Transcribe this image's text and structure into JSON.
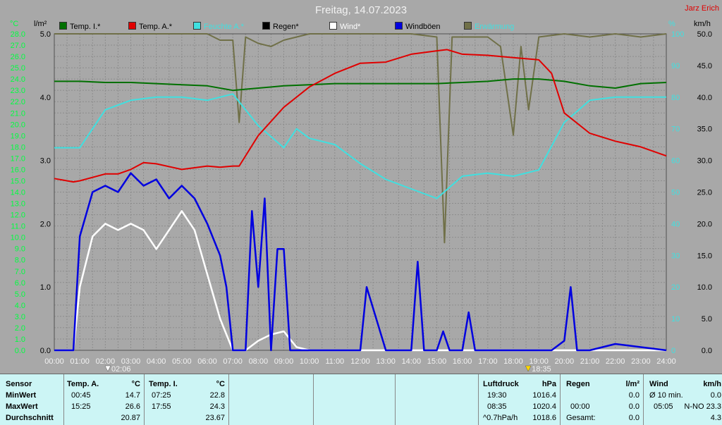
{
  "title": "Freitag, 14.07.2023",
  "author": "Jarz Erich",
  "axis_units": {
    "temp": "°C",
    "rain": "l/m²",
    "humidity": "%",
    "wind": "km/h"
  },
  "legend": [
    {
      "label": "Temp. I.*",
      "color": "#007000",
      "text_color": "#000000"
    },
    {
      "label": "Temp. A.*",
      "color": "#e00000",
      "text_color": "#000000"
    },
    {
      "label": "Feuchte A.*",
      "color": "#40e0e0",
      "text_color": "#40e0e0"
    },
    {
      "label": "Regen*",
      "color": "#000000",
      "text_color": "#000000"
    },
    {
      "label": "Wind*",
      "color": "#ffffff",
      "text_color": "#ffffff"
    },
    {
      "label": "Windböen",
      "color": "#0000e0",
      "text_color": "#000000"
    },
    {
      "label": "Erwärmung",
      "color": "#707048",
      "text_color": "#40e0e0"
    }
  ],
  "marker_labels": {
    "sunrise": "02:06",
    "sunset": "18:35"
  },
  "chart_data": {
    "type": "line",
    "xlabel": "",
    "x_range": [
      "00:00",
      "24:00"
    ],
    "x_ticks": [
      "00:00",
      "01:00",
      "02:00",
      "03:00",
      "04:00",
      "05:00",
      "06:00",
      "07:00",
      "08:00",
      "09:00",
      "10:00",
      "11:00",
      "12:00",
      "13:00",
      "14:00",
      "15:00",
      "16:00",
      "17:00",
      "18:00",
      "19:00",
      "20:00",
      "21:00",
      "22:00",
      "23:00",
      "24:00"
    ],
    "axes": {
      "temp": {
        "label": "°C",
        "range": [
          0,
          28
        ],
        "ticks": [
          "0.0",
          "1.0",
          "2.0",
          "3.0",
          "4.0",
          "5.0",
          "6.0",
          "7.0",
          "8.0",
          "9.0",
          "10.0",
          "11.0",
          "12.0",
          "13.0",
          "14.0",
          "15.0",
          "16.0",
          "17.0",
          "18.0",
          "19.0",
          "20.0",
          "21.0",
          "22.0",
          "23.0",
          "24.0",
          "25.0",
          "26.0",
          "27.0",
          "28.0"
        ]
      },
      "rain": {
        "label": "l/m²",
        "range": [
          0,
          5
        ],
        "ticks": [
          "0.0",
          "1.0",
          "2.0",
          "3.0",
          "4.0",
          "5.0"
        ]
      },
      "humidity": {
        "label": "%",
        "range": [
          0,
          100
        ],
        "ticks": [
          "0",
          "10",
          "20",
          "30",
          "40",
          "50",
          "60",
          "70",
          "80",
          "90",
          "100"
        ]
      },
      "wind": {
        "label": "km/h",
        "range": [
          0,
          50
        ],
        "ticks": [
          "0.0",
          "5.0",
          "10.0",
          "15.0",
          "20.0",
          "25.0",
          "30.0",
          "35.0",
          "40.0",
          "45.0",
          "50.0"
        ]
      }
    },
    "series": [
      {
        "name": "Temp. I.*",
        "axis": "temp",
        "color": "#007000",
        "x": [
          0,
          1,
          2,
          3,
          4,
          5,
          6,
          7,
          8,
          9,
          10,
          11,
          12,
          13,
          14,
          15,
          16,
          17,
          18,
          19,
          20,
          21,
          22,
          23,
          24
        ],
        "y": [
          23.8,
          23.8,
          23.7,
          23.7,
          23.6,
          23.5,
          23.4,
          23.0,
          23.2,
          23.4,
          23.5,
          23.6,
          23.6,
          23.6,
          23.6,
          23.6,
          23.7,
          23.8,
          24.0,
          24.0,
          23.8,
          23.4,
          23.2,
          23.6,
          23.7
        ]
      },
      {
        "name": "Temp. A.*",
        "axis": "temp",
        "color": "#e00000",
        "x": [
          0,
          0.75,
          1,
          2,
          2.5,
          3,
          3.5,
          4,
          5,
          6,
          6.5,
          7,
          7.25,
          8,
          9,
          10,
          11,
          12,
          13,
          14,
          15,
          15.4,
          16,
          17,
          18,
          19,
          19.5,
          20,
          21,
          22,
          23,
          24
        ],
        "y": [
          15.2,
          14.9,
          15.0,
          15.6,
          15.6,
          16.0,
          16.6,
          16.5,
          16.0,
          16.3,
          16.2,
          16.3,
          16.3,
          19.0,
          21.5,
          23.3,
          24.5,
          25.4,
          25.5,
          26.2,
          26.5,
          26.6,
          26.2,
          26.1,
          25.9,
          25.7,
          24.5,
          21.0,
          19.2,
          18.5,
          18.0,
          17.2
        ]
      },
      {
        "name": "Feuchte A.*",
        "axis": "humidity",
        "color": "#40e0e0",
        "x": [
          0,
          1,
          2,
          3,
          4,
          5,
          6,
          7,
          8,
          9,
          9.5,
          10,
          11,
          12,
          13,
          14,
          15,
          16,
          17,
          18,
          19,
          20,
          21,
          22,
          23,
          24
        ],
        "y": [
          64,
          64,
          76,
          79,
          80,
          80,
          79,
          81,
          71,
          64,
          70,
          67,
          65,
          59,
          54,
          51,
          48,
          55,
          56,
          55,
          57,
          72,
          79,
          80,
          80,
          80
        ]
      },
      {
        "name": "Wind*",
        "axis": "wind",
        "color": "#ffffff",
        "x": [
          0,
          0.75,
          1,
          1.5,
          2,
          2.5,
          3,
          3.5,
          4,
          4.5,
          5,
          5.5,
          6,
          6.5,
          7,
          7.5,
          8,
          8.5,
          9,
          9.5,
          10,
          24
        ],
        "y": [
          0,
          0,
          10,
          18,
          20,
          19,
          20,
          19,
          16,
          19,
          22,
          19,
          12,
          5,
          0,
          0,
          1.5,
          2.5,
          3,
          0.5,
          0,
          0
        ]
      },
      {
        "name": "Windböen",
        "axis": "wind",
        "color": "#0000e0",
        "x": [
          0,
          0.75,
          1,
          1.5,
          2,
          2.5,
          3,
          3.5,
          4,
          4.5,
          5,
          5.5,
          6,
          6.5,
          6.75,
          7,
          7.5,
          7.75,
          8,
          8.25,
          8.5,
          8.75,
          9,
          9.25,
          9.5,
          10,
          12,
          12.25,
          13,
          13.25,
          14,
          14.25,
          14.5,
          15,
          15.25,
          15.5,
          16,
          16.25,
          16.5,
          17,
          19,
          19.5,
          20,
          20.25,
          20.5,
          21,
          22,
          24
        ],
        "y": [
          0,
          0,
          18,
          25,
          26,
          25,
          28,
          26,
          27,
          24,
          26,
          24,
          20,
          15,
          10,
          0,
          0,
          22,
          10,
          24,
          0,
          16,
          16,
          0,
          0,
          0,
          0,
          10,
          0,
          0,
          0,
          14,
          0,
          0,
          3,
          0,
          0,
          6,
          0,
          0,
          0,
          0,
          1.5,
          10,
          0,
          0,
          1,
          0
        ]
      },
      {
        "name": "Erwärmung",
        "axis": "humidity",
        "color": "#707048",
        "x": [
          0,
          2,
          4,
          6,
          6.5,
          7,
          7.25,
          7.5,
          8,
          8.5,
          9,
          10,
          12,
          14,
          15,
          15.3,
          15.6,
          16,
          17,
          17.5,
          18,
          18.3,
          18.6,
          19,
          20,
          21,
          22,
          23,
          24
        ],
        "y": [
          100,
          100,
          100,
          100,
          98,
          98,
          72,
          99,
          97,
          96,
          98,
          100,
          100,
          100,
          99,
          34,
          99,
          99,
          99,
          96,
          68,
          96,
          76,
          99,
          100,
          99,
          100,
          99,
          100
        ]
      }
    ]
  },
  "footer": {
    "sensor": {
      "header": "Sensor",
      "rows": [
        "MinWert",
        "MaxWert",
        "Durchschnitt"
      ]
    },
    "temp_a": {
      "header": "Temp. A.",
      "unit": "°C",
      "rows": [
        [
          "00:45",
          "14.7"
        ],
        [
          "15:25",
          "26.6"
        ],
        [
          "",
          "20.87"
        ]
      ]
    },
    "temp_i": {
      "header": "Temp. I.",
      "unit": "°C",
      "rows": [
        [
          "07:25",
          "22.8"
        ],
        [
          "17:55",
          "24.3"
        ],
        [
          "",
          "23.67"
        ]
      ]
    },
    "pressure": {
      "header": "Luftdruck",
      "unit": "hPa",
      "rows": [
        [
          "19:30",
          "1016.4"
        ],
        [
          "08:35",
          "1020.4"
        ],
        [
          "^0.7hPa/h",
          "1018.6"
        ]
      ]
    },
    "rain": {
      "header": "Regen",
      "unit": "l/m²",
      "rows": [
        [
          "",
          ""
        ],
        [
          "00:00",
          "0.0"
        ],
        [
          "Gesamt:",
          "0.0"
        ]
      ],
      "row0_value": "0.0"
    },
    "wind": {
      "header": "Wind",
      "unit": "km/h",
      "rows": [
        [
          "Ø 10 min.",
          "0.0"
        ],
        [
          "05:05",
          "N-NO 23.3"
        ],
        [
          "",
          "4.3"
        ]
      ]
    }
  }
}
